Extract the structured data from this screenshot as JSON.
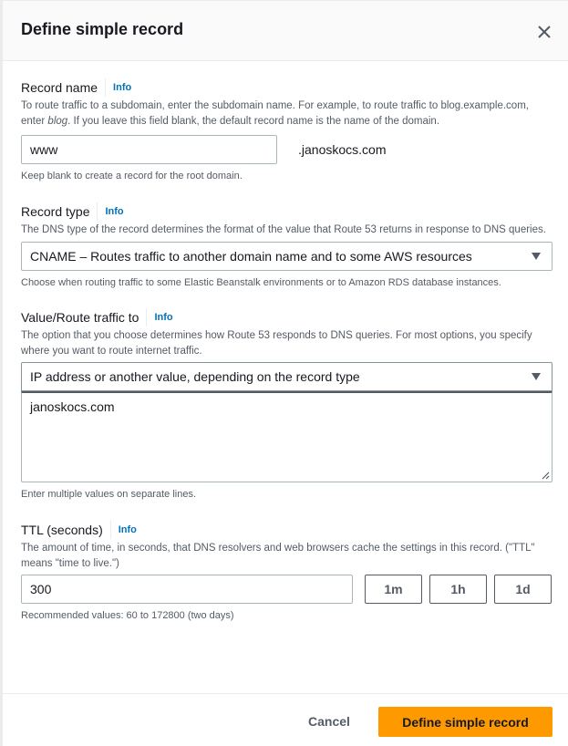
{
  "modal": {
    "title": "Define simple record",
    "close_icon": "close-icon"
  },
  "record_name": {
    "label": "Record name",
    "info": "Info",
    "description_part1": "To route traffic to a subdomain, enter the subdomain name. For example, to route traffic to blog.example.com, enter ",
    "description_italic": "blog",
    "description_part2": ". If you leave this field blank, the default record name is the name of the domain.",
    "value": "www",
    "suffix": ".janoskocs.com",
    "constraint": "Keep blank to create a record for the root domain."
  },
  "record_type": {
    "label": "Record type",
    "info": "Info",
    "description": "The DNS type of the record determines the format of the value that Route 53 returns in response to DNS queries.",
    "selected": "CNAME – Routes traffic to another domain name and to some AWS resources",
    "constraint": "Choose when routing traffic to some Elastic Beanstalk environments or to Amazon RDS database instances."
  },
  "value_route": {
    "label": "Value/Route traffic to",
    "info": "Info",
    "description": "The option that you choose determines how Route 53 responds to DNS queries. For most options, you specify where you want to route internet traffic.",
    "selected": "IP address or another value, depending on the record type",
    "value": "janoskocs.com",
    "constraint": "Enter multiple values on separate lines."
  },
  "ttl": {
    "label": "TTL (seconds)",
    "info": "Info",
    "description": "The amount of time, in seconds, that DNS resolvers and web browsers cache the settings in this record. (\"TTL\" means \"time to live.\")",
    "value": "300",
    "buttons": [
      "1m",
      "1h",
      "1d"
    ],
    "constraint": "Recommended values: 60 to 172800 (two days)"
  },
  "footer": {
    "cancel_label": "Cancel",
    "submit_label": "Define simple record"
  },
  "colors": {
    "primary": "#ff9900",
    "link": "#0073bb"
  }
}
